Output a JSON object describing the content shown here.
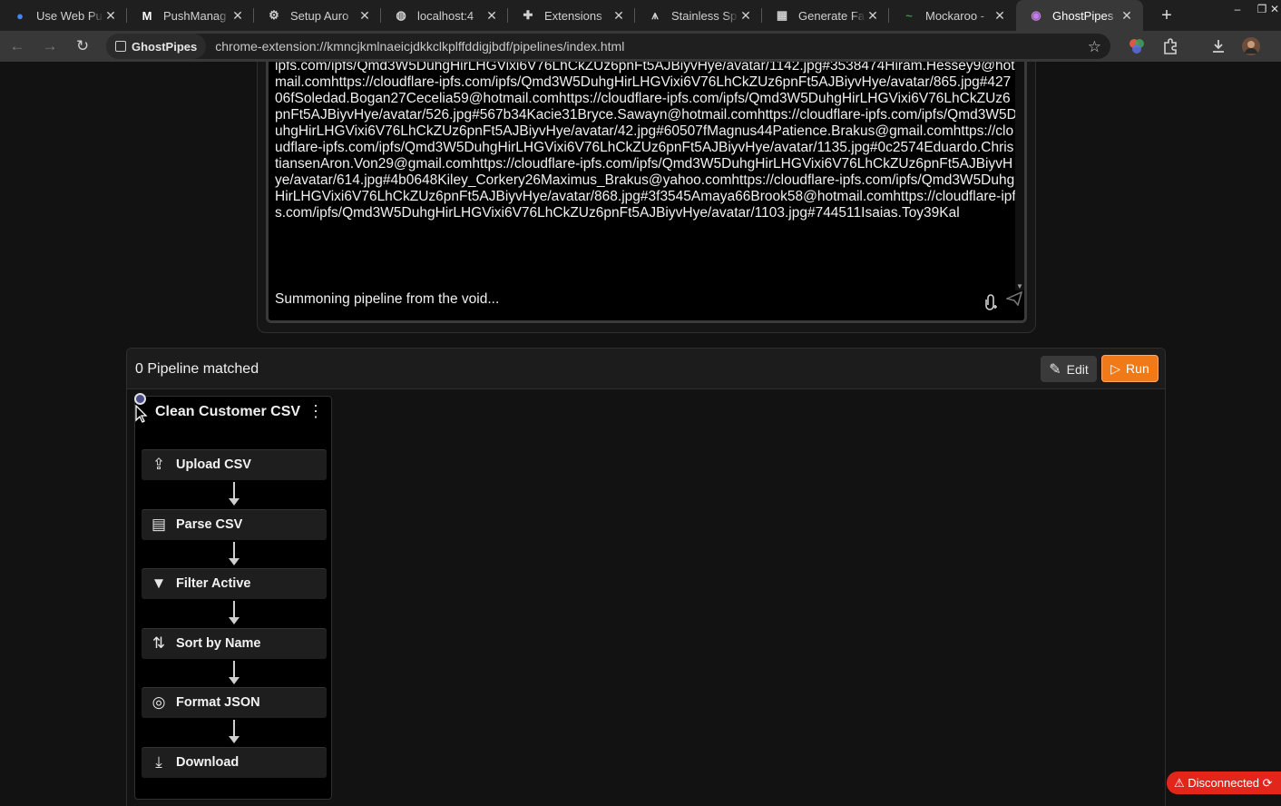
{
  "browser": {
    "tabs": [
      {
        "title": "Use Web Pu",
        "icon": "chrome-icon",
        "glyph": "●",
        "color": "#4285f4"
      },
      {
        "title": "PushManag",
        "icon": "mdn-icon",
        "glyph": "M",
        "color": "#ffffff"
      },
      {
        "title": "Setup Auro",
        "icon": "gear-icon",
        "glyph": "⚙",
        "color": "#d0d0d0"
      },
      {
        "title": "localhost:4",
        "icon": "globe-icon",
        "glyph": "◍",
        "color": "#d0d0d0"
      },
      {
        "title": "Extensions",
        "icon": "puzzle-icon",
        "glyph": "✚",
        "color": "#d0d0d0"
      },
      {
        "title": "Stainless Sp",
        "icon": "stainless-icon",
        "glyph": "⩚",
        "color": "#d0d0d0"
      },
      {
        "title": "Generate Fa",
        "icon": "table-icon",
        "glyph": "▦",
        "color": "#d0d0d0"
      },
      {
        "title": "Mockaroo -",
        "icon": "mockaroo-icon",
        "glyph": "~",
        "color": "#2e9a3d"
      },
      {
        "title": "GhostPipes",
        "icon": "ghostpipes-icon",
        "glyph": "◉",
        "color": "#c27ee0"
      }
    ],
    "active_tab_index": 8,
    "new_tab": "+",
    "window_controls": {
      "minimize": "–",
      "restore": "❐",
      "close": "✕"
    },
    "extension_chip": "GhostPipes",
    "url": "chrome-extension://kmncjkmlnaeicjdkkclkplffddigjbdf/pipelines/index.html"
  },
  "prompt": {
    "text": "ipfs.com/ipfs/Qmd3W5DuhgHirLHGVixi6V76LhCkZUz6pnFt5AJBiyvHye/avatar/1142.jpg#3538474Hiram.Hessey9@hotmail.comhttps://cloudflare-ipfs.com/ipfs/Qmd3W5DuhgHirLHGVixi6V76LhCkZUz6pnFt5AJBiyvHye/avatar/865.jpg#42706fSoledad.Bogan27Cecelia59@hotmail.comhttps://cloudflare-ipfs.com/ipfs/Qmd3W5DuhgHirLHGVixi6V76LhCkZUz6pnFt5AJBiyvHye/avatar/526.jpg#567b34Kacie31Bryce.Sawayn@hotmail.comhttps://cloudflare-ipfs.com/ipfs/Qmd3W5DuhgHirLHGVixi6V76LhCkZUz6pnFt5AJBiyvHye/avatar/42.jpg#60507fMagnus44Patience.Brakus@gmail.comhttps://cloudflare-ipfs.com/ipfs/Qmd3W5DuhgHirLHGVixi6V76LhCkZUz6pnFt5AJBiyvHye/avatar/1135.jpg#0c2574Eduardo.ChristiansenAron.Von29@gmail.comhttps://cloudflare-ipfs.com/ipfs/Qmd3W5DuhgHirLHGVixi6V76LhCkZUz6pnFt5AJBiyvHye/avatar/614.jpg#4b0648Kiley_Corkery26Maximus_Brakus@yahoo.comhttps://cloudflare-ipfs.com/ipfs/Qmd3W5DuhgHirLHGVixi6V76LhCkZUz6pnFt5AJBiyvHye/avatar/868.jpg#3f3545Amaya66Brook58@hotmail.comhttps://cloudflare-ipfs.com/ipfs/Qmd3W5DuhgHirLHGVixi6V76LhCkZUz6pnFt5AJBiyvHye/avatar/1103.jpg#744511Isaias.Toy39Kal",
    "status": "Summoning pipeline from the void..."
  },
  "results": {
    "match_count": "0 Pipeline matched",
    "edit_label": "Edit",
    "run_label": "Run",
    "pipeline": {
      "title": "Clean Customer CSV",
      "menu": "⋮",
      "steps": [
        {
          "label": "Upload CSV",
          "icon": "upload-icon",
          "glyph": "⇪"
        },
        {
          "label": "Parse CSV",
          "icon": "parse-file-icon",
          "glyph": "▤"
        },
        {
          "label": "Filter Active",
          "icon": "filter-icon",
          "glyph": "▼"
        },
        {
          "label": "Sort by Name",
          "icon": "sort-icon",
          "glyph": "⇅"
        },
        {
          "label": "Format JSON",
          "icon": "spiral-icon",
          "glyph": "◎"
        },
        {
          "label": "Download",
          "icon": "download-icon",
          "glyph": "⤓"
        }
      ]
    }
  },
  "connection_status": "⚠ Disconnected ⟳"
}
